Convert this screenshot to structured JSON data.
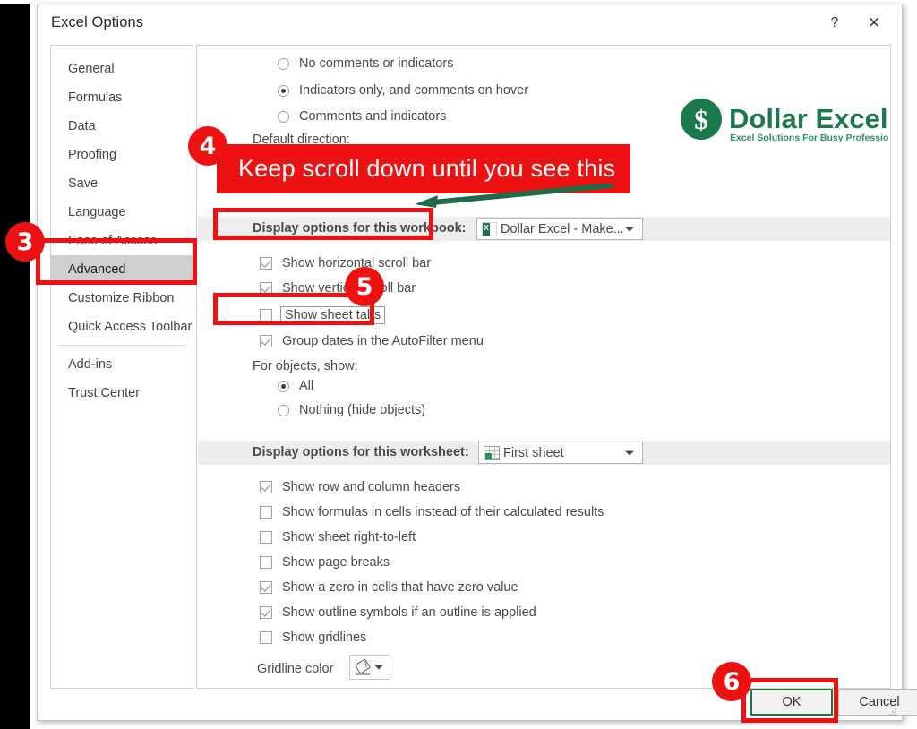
{
  "window": {
    "title": "Excel Options",
    "help_label": "?",
    "close_label": "✕"
  },
  "sidebar": {
    "items": [
      {
        "label": "General",
        "selected": false
      },
      {
        "label": "Formulas",
        "selected": false
      },
      {
        "label": "Data",
        "selected": false
      },
      {
        "label": "Proofing",
        "selected": false
      },
      {
        "label": "Save",
        "selected": false
      },
      {
        "label": "Language",
        "selected": false
      },
      {
        "label": "Ease of Access",
        "selected": false
      },
      {
        "label": "Advanced",
        "selected": true
      },
      {
        "label": "Customize Ribbon",
        "selected": false
      },
      {
        "label": "Quick Access Toolbar",
        "selected": false
      },
      {
        "label": "Add-ins",
        "selected": false
      },
      {
        "label": "Trust Center",
        "selected": false
      }
    ]
  },
  "main": {
    "comment_radios": [
      {
        "label": "No comments or indicators",
        "checked": false
      },
      {
        "label": "Indicators only, and comments on hover",
        "checked": true
      },
      {
        "label": "Comments and indicators",
        "checked": false
      }
    ],
    "default_direction_label": "Default direction:",
    "workbook_section": {
      "title": "Display options for this workbook:",
      "combo_value": "Dollar Excel - Make...",
      "combo_icon": "excel-file-icon",
      "checkboxes": [
        {
          "label": "Show horizontal scroll bar",
          "checked": true
        },
        {
          "label": "Show vertical scroll bar",
          "checked": true
        },
        {
          "label": "Show sheet tabs",
          "checked": false
        },
        {
          "label": "Group dates in the AutoFilter menu",
          "checked": true
        }
      ],
      "objects_label": "For objects, show:",
      "objects_radios": [
        {
          "label": "All",
          "checked": true
        },
        {
          "label": "Nothing (hide objects)",
          "checked": false
        }
      ]
    },
    "worksheet_section": {
      "title": "Display options for this worksheet:",
      "combo_value": "First sheet",
      "combo_icon": "worksheet-icon",
      "checkboxes": [
        {
          "label": "Show row and column headers",
          "checked": true
        },
        {
          "label": "Show formulas in cells instead of their calculated results",
          "checked": false
        },
        {
          "label": "Show sheet right-to-left",
          "checked": false
        },
        {
          "label": "Show page breaks",
          "checked": false
        },
        {
          "label": "Show a zero in cells that have zero value",
          "checked": true
        },
        {
          "label": "Show outline symbols if an outline is applied",
          "checked": true
        },
        {
          "label": "Show gridlines",
          "checked": false
        }
      ],
      "gridline_color_label": "Gridline color",
      "gridline_color_icon": "fill-bucket-icon"
    }
  },
  "footer": {
    "ok_label": "OK",
    "cancel_label": "Cancel"
  },
  "annotations": {
    "step3": "3",
    "step4": "4",
    "step5": "5",
    "step6": "6",
    "banner_text": "Keep scroll down until you see this"
  },
  "branding": {
    "name": "Dollar Excel",
    "tagline": "Excel Solutions For Busy Professionals",
    "symbol": "$",
    "color": "#1a7a4c"
  },
  "colors": {
    "annotation_red": "#ee1111",
    "excel_green": "#217346",
    "arrow_green": "#1f6b45",
    "selected_nav": "#cfcfcf"
  }
}
